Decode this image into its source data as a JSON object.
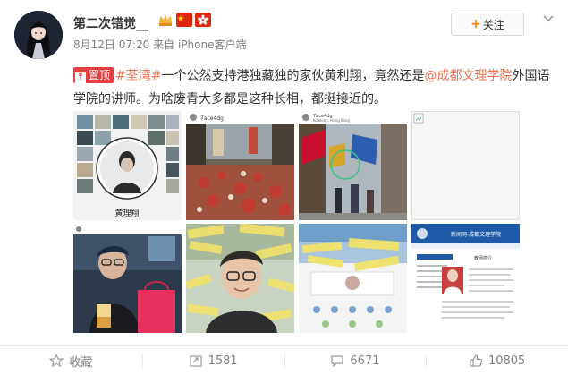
{
  "post": {
    "user_name": "第二次错觉__",
    "timestamp": "8月12日 07:20",
    "source_prefix": "来自",
    "source": "iPhone客户端",
    "follow_label": "关注",
    "pin_label": "置顶",
    "topic": "#荃湾#",
    "text_a": "一个公然支持港独藏独的家伙黄利翔，竟然还是",
    "mention": "@成都文理学院",
    "text_b": "外国语学院的讲师。为啥废青大多都是这种长相，都挺接近的。"
  },
  "images": {
    "profile_name": "黄理翔",
    "post_meta": "7ace4dg",
    "post_sub": "Kowloon, Hong Kong",
    "school_title": "新闻网-成都文理学院",
    "staff_label": "教师简介"
  },
  "footer": {
    "collect_label": "收藏",
    "repost_count": "1581",
    "comment_count": "6671",
    "like_count": "10805"
  },
  "colors": {
    "accent": "#ff8200",
    "link": "#eb7350",
    "pin": "#e23f3f"
  }
}
